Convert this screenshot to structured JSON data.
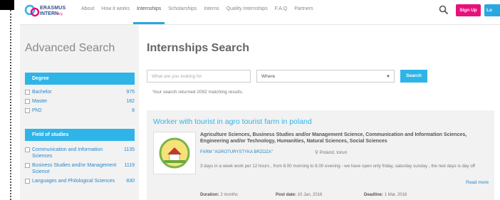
{
  "logo": {
    "line1": "ERASMUS",
    "line2": "INTERN",
    "suffix": ".org"
  },
  "nav": [
    "About",
    "How it works",
    "Internships",
    "Scholarships",
    "Interns",
    "Quality Internships",
    "F.A.Q",
    "Partners"
  ],
  "header": {
    "signup_label": "Sign Up",
    "login_label": "Lo"
  },
  "sidebar": {
    "title": "Advanced Search",
    "degree": {
      "heading": "Degree",
      "items": [
        {
          "label": "Bachelor",
          "count": "975"
        },
        {
          "label": "Master",
          "count": "182"
        },
        {
          "label": "PhD",
          "count": "8"
        }
      ]
    },
    "fields": {
      "heading": "Field of studies",
      "items": [
        {
          "label": "Communication and Information Sciences",
          "count": "1135"
        },
        {
          "label": "Business Studies and/or Management Science",
          "count": "1119"
        },
        {
          "label": "Languages and Philological Sciences",
          "count": "830"
        }
      ]
    }
  },
  "main": {
    "title": "Internships Search",
    "what_placeholder": "What are you looking for",
    "where_value": "Where",
    "search_button": "Search",
    "result_count": "Your search returned 2092 matching results."
  },
  "card": {
    "title": "Worker with tourist in agro tourist farm in poland",
    "fields": "Agriculture Sciences, Business Studies and/or Management Science, Communication and Information Sciences, Engineering and/or Technology, Humanities, Natural Sciences, Social Sciences",
    "company": "FARM \"AGROTURYSTYKA BRZOZA\"",
    "location": "Poland, torun",
    "description": "3 days in a week work per 12 hours , from 8.00 morning to 8.00 evening - we have open only friday, saturday sunday , the rest days is day off",
    "read_more": "Read more",
    "duration_label": "Duration:",
    "duration_value": "2 months",
    "post_label": "Post date:",
    "post_value": "10 Jan, 2016",
    "deadline_label": "Deadline:",
    "deadline_value": "1 Mar, 2016"
  },
  "colors": {
    "accent": "#2fb4e8",
    "signup": "#e8107a",
    "link": "#2a86c9"
  }
}
